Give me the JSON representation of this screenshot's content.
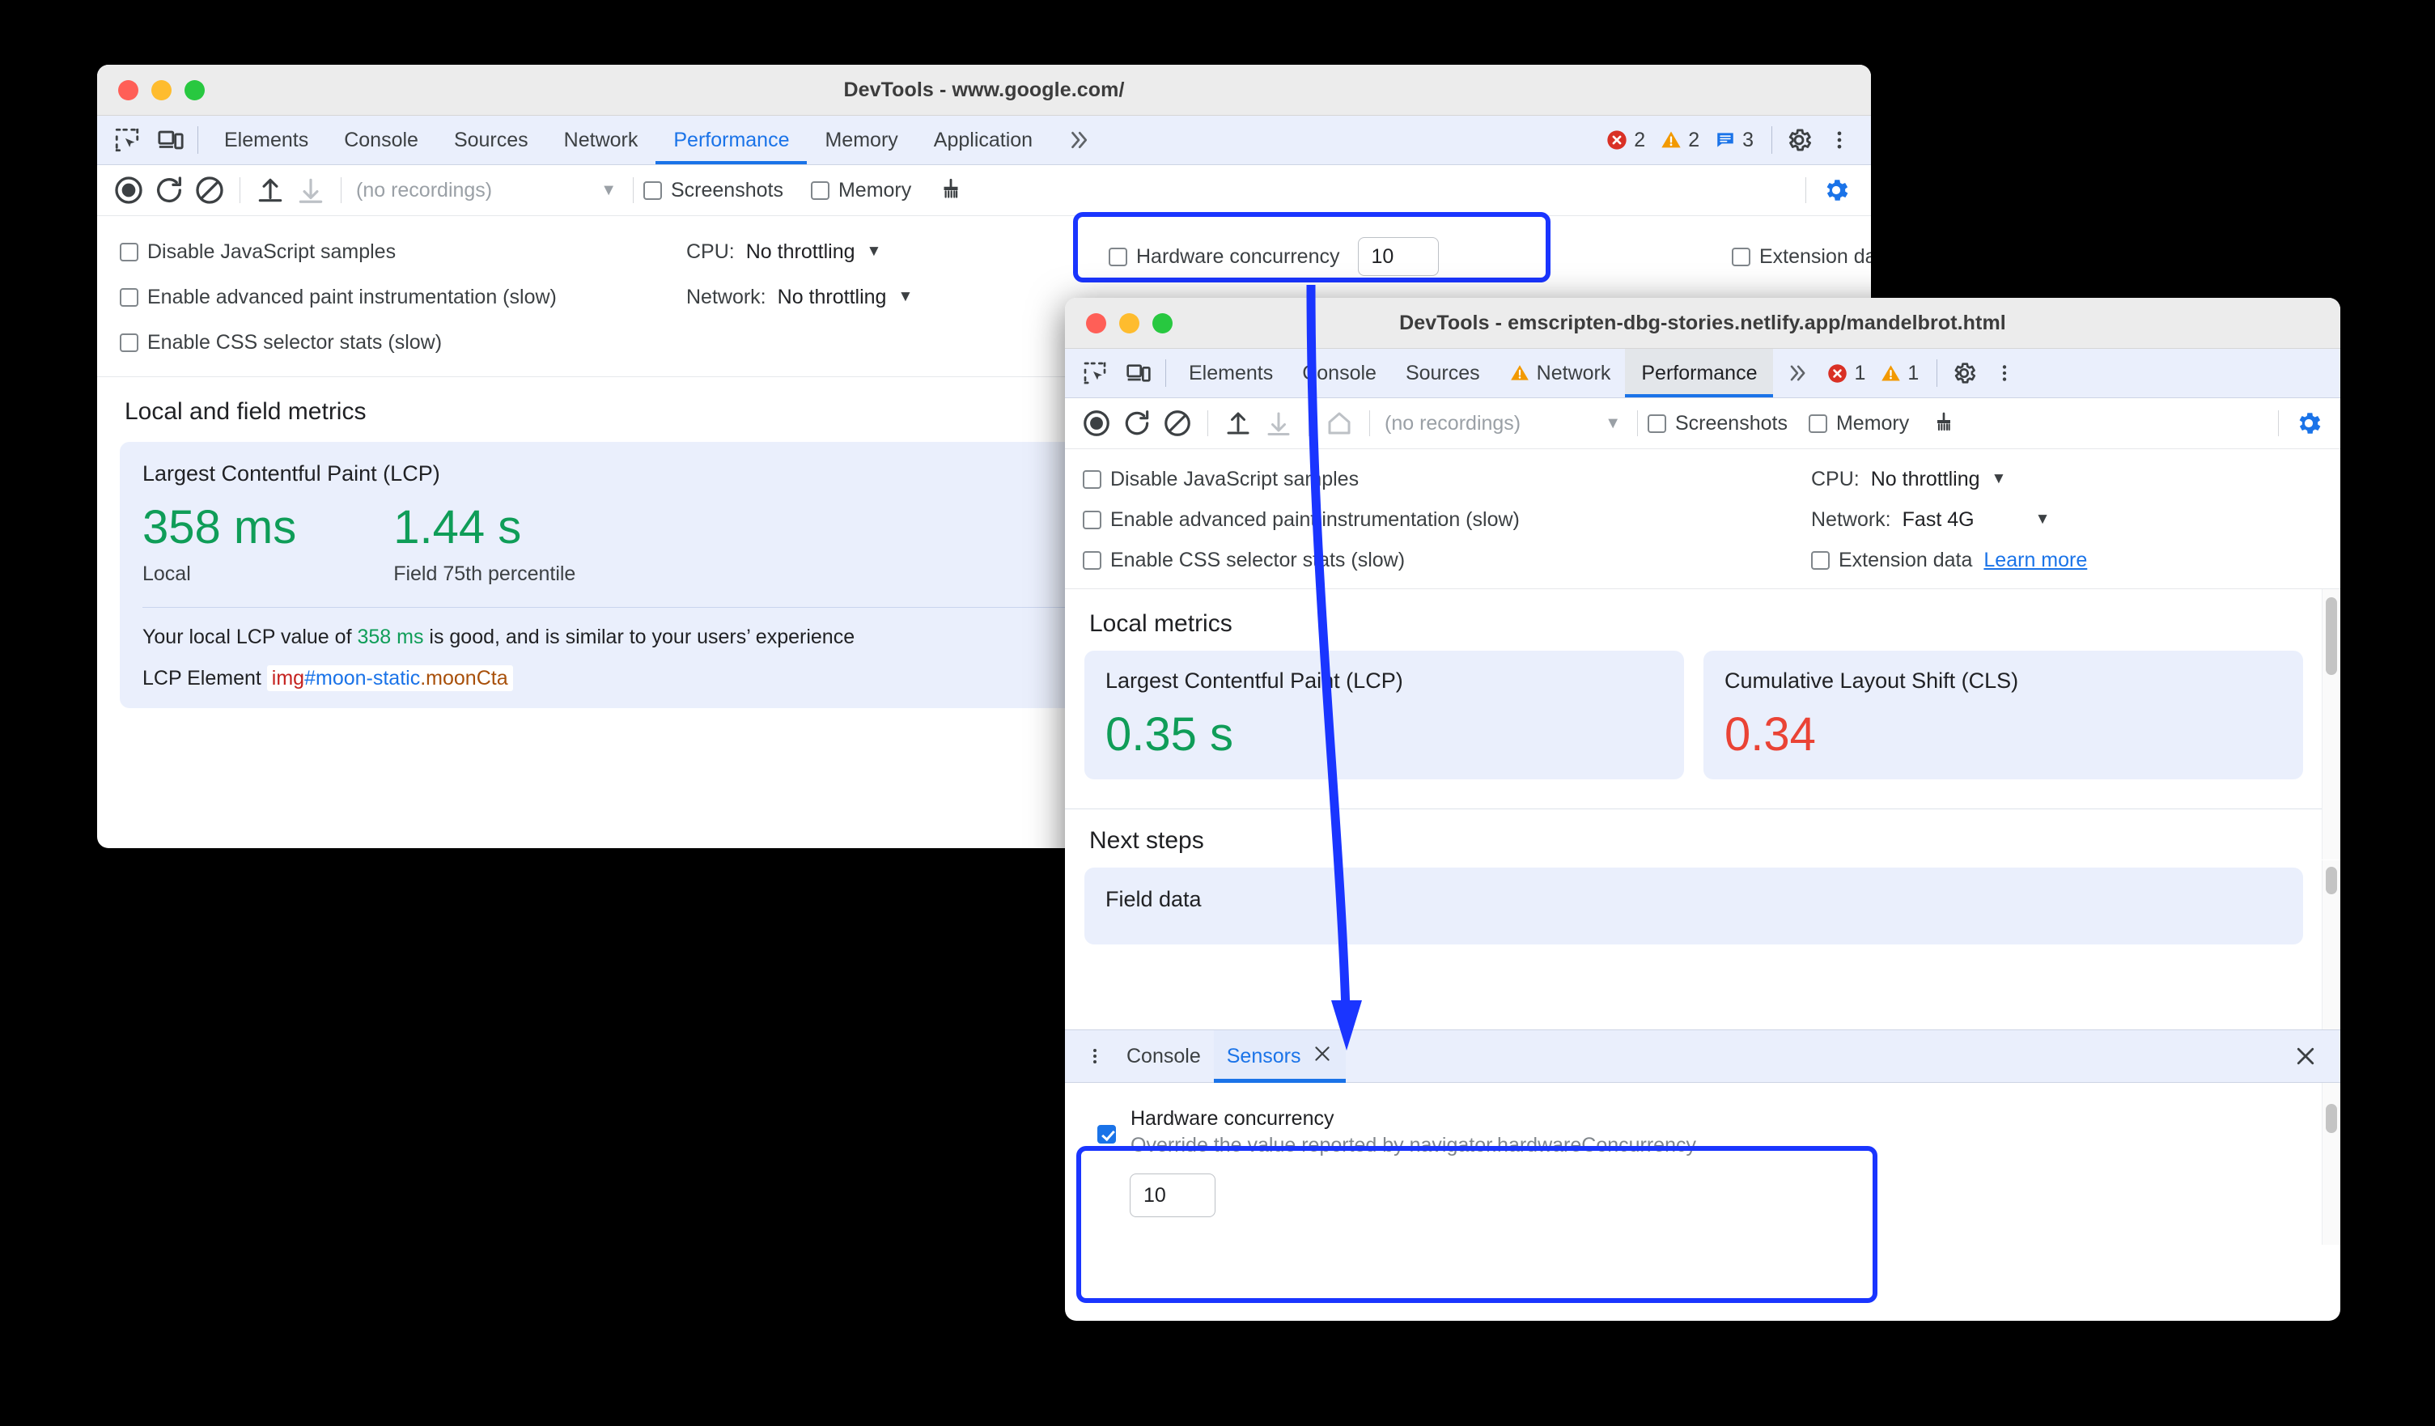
{
  "window1": {
    "title": "DevTools - www.google.com/",
    "traffic_lights": [
      "close",
      "minimize",
      "zoom"
    ],
    "tool_icons": [
      "inspect-element-icon",
      "device-toolbar-icon"
    ],
    "tabs": [
      {
        "label": "Elements",
        "active": false
      },
      {
        "label": "Console",
        "active": false
      },
      {
        "label": "Sources",
        "active": false
      },
      {
        "label": "Network",
        "active": false
      },
      {
        "label": "Performance",
        "active": true
      },
      {
        "label": "Memory",
        "active": false
      },
      {
        "label": "Application",
        "active": false
      }
    ],
    "more_tabs": "»",
    "counters": {
      "errors": "2",
      "warnings": "2",
      "info": "3"
    },
    "toolbar": {
      "record": "record-icon",
      "reload": "reload-record-icon",
      "clear": "clear-icon",
      "upload": "upload-icon",
      "download": "download-icon",
      "recordings_value": "(no recordings)",
      "screenshots_label": "Screenshots",
      "screenshots_checked": false,
      "memory_label": "Memory",
      "memory_checked": false,
      "gc_icon": "collect-garbage-icon",
      "settings_icon": "gear-icon-active"
    },
    "settings": {
      "disable_js_samples": "Disable JavaScript samples",
      "disable_js_samples_checked": false,
      "advanced_paint": "Enable advanced paint instrumentation (slow)",
      "advanced_paint_checked": false,
      "css_selector_stats": "Enable CSS selector stats (slow)",
      "css_selector_stats_checked": false,
      "cpu_label": "CPU:",
      "cpu_value": "No throttling",
      "network_label": "Network:",
      "network_value": "No throttling",
      "hardware_concurrency_label": "Hardware concurrency",
      "hardware_concurrency_checked": false,
      "hardware_concurrency_value": "10",
      "extension_data_label": "Extension data",
      "extension_data_checked": false
    },
    "metrics": {
      "section_title": "Local and field metrics",
      "card_title": "Largest Contentful Paint (LCP)",
      "local_value": "358 ms",
      "local_label": "Local",
      "field_value": "1.44 s",
      "field_label": "Field 75th percentile",
      "description_pre": "Your local LCP value of ",
      "description_value": "358 ms",
      "description_post": " is good, and is similar to your users’ experience",
      "lcp_element_label": "LCP Element",
      "lcp_element_tag": "img",
      "lcp_element_id": "#moon-static",
      "lcp_element_class": ".moonCta"
    }
  },
  "window2": {
    "title": "DevTools - emscripten-dbg-stories.netlify.app/mandelbrot.html",
    "tool_icons": [
      "inspect-element-icon",
      "device-toolbar-icon"
    ],
    "tabs": [
      {
        "label": "Elements",
        "active": false,
        "warn": false
      },
      {
        "label": "Console",
        "active": false,
        "warn": false
      },
      {
        "label": "Sources",
        "active": false,
        "warn": false
      },
      {
        "label": "Network",
        "active": false,
        "warn": true
      },
      {
        "label": "Performance",
        "active": true,
        "warn": false
      }
    ],
    "more_tabs": "»",
    "counters": {
      "errors": "1",
      "warnings": "1"
    },
    "toolbar": {
      "recordings_value": "(no recordings)",
      "screenshots_label": "Screenshots",
      "screenshots_checked": false,
      "memory_label": "Memory",
      "memory_checked": false,
      "home_icon": "home-icon",
      "gc_icon": "collect-garbage-icon",
      "settings_icon": "gear-icon-active"
    },
    "settings": {
      "disable_js_samples": "Disable JavaScript samples",
      "disable_js_samples_checked": false,
      "advanced_paint": "Enable advanced paint instrumentation (slow)",
      "advanced_paint_checked": false,
      "css_selector_stats": "Enable CSS selector stats (slow)",
      "css_selector_stats_checked": false,
      "cpu_label": "CPU:",
      "cpu_value": "No throttling",
      "network_label": "Network:",
      "network_value": "Fast 4G",
      "extension_data_label": "Extension data",
      "extension_data_checked": false,
      "learn_more": "Learn more"
    },
    "metrics": {
      "section_title": "Local metrics",
      "lcp_title": "Largest Contentful Paint (LCP)",
      "lcp_value": "0.35 s",
      "cls_title": "Cumulative Layout Shift (CLS)",
      "cls_value": "0.34",
      "next_steps_title": "Next steps",
      "field_data_title": "Field data"
    },
    "drawer": {
      "menu_icon": "more-options-icon",
      "tabs": [
        {
          "label": "Console",
          "active": false,
          "closable": false
        },
        {
          "label": "Sensors",
          "active": true,
          "closable": true
        }
      ],
      "close_icon": "close-icon",
      "sensor": {
        "name": "Hardware concurrency",
        "checked": true,
        "description": "Override the value reported by navigator.hardwareConcurrency",
        "value": "10"
      }
    }
  },
  "annotations": {
    "highlight_color": "#1a35ff",
    "arrow": "callout-arrow-from-toolbar-to-sensors-tab"
  }
}
